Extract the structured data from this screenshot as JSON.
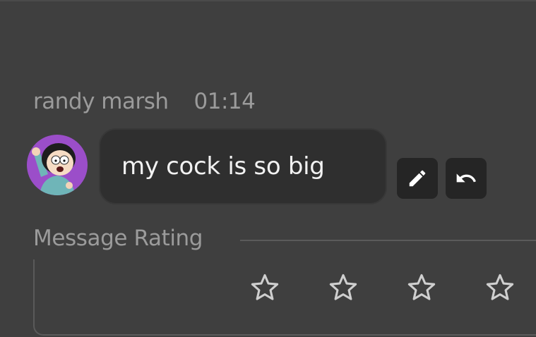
{
  "message": {
    "author": "randy marsh",
    "time": "01:14",
    "text": "my cock is so big",
    "avatar_icon": "randy-marsh-avatar",
    "actions": [
      {
        "name": "edit",
        "icon": "pencil-icon"
      },
      {
        "name": "undo",
        "icon": "undo-icon"
      }
    ]
  },
  "rating": {
    "label": "Message Rating",
    "max_stars": 4,
    "selected": 0,
    "star_icon": "star-outline-icon"
  },
  "colors": {
    "background": "#3f3f3f",
    "bubble": "#2f2f2f",
    "muted_text": "#9b9b9b",
    "avatar_bg": "#9b4ec9",
    "button_bg": "#252525"
  }
}
